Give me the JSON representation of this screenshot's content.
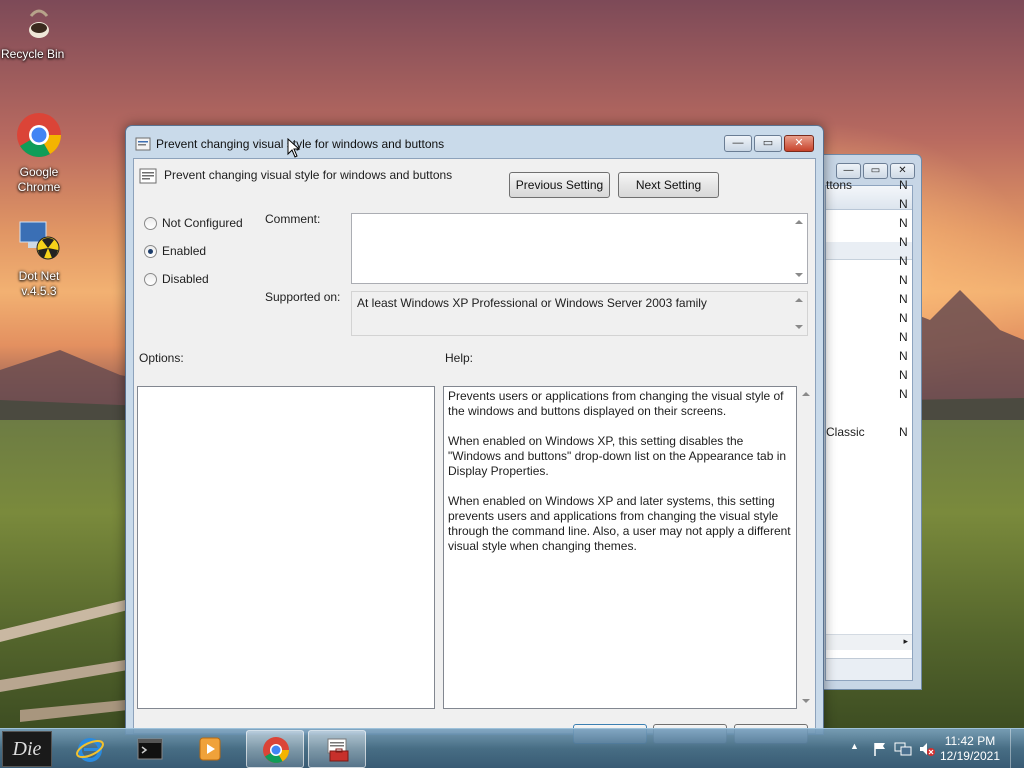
{
  "desktop": {
    "icons": [
      {
        "label": "Recycle Bin"
      },
      {
        "label": "Google Chrome"
      },
      {
        "label": "Dot Net v.4.5.3"
      }
    ]
  },
  "background_window": {
    "rows": [
      {
        "a": "ttons",
        "b": "N"
      },
      {
        "a": "",
        "b": "N"
      },
      {
        "a": "",
        "b": "N"
      },
      {
        "a": "",
        "b": "N"
      },
      {
        "a": "",
        "b": "N"
      },
      {
        "a": "",
        "b": "N"
      },
      {
        "a": "",
        "b": "N"
      },
      {
        "a": "",
        "b": "N"
      },
      {
        "a": "",
        "b": "N"
      },
      {
        "a": "",
        "b": "N"
      },
      {
        "a": "",
        "b": "N"
      },
      {
        "a": "",
        "b": "N"
      },
      {
        "a": "Classic",
        "b": "N"
      }
    ]
  },
  "dialog": {
    "title": "Prevent changing visual style for windows and buttons",
    "policy_name": "Prevent changing visual style for windows and buttons",
    "previous_setting": "Previous Setting",
    "next_setting": "Next Setting",
    "radios": {
      "not_configured": "Not Configured",
      "enabled": "Enabled",
      "disabled": "Disabled",
      "selected": "Enabled"
    },
    "comment_label": "Comment:",
    "comment_value": "",
    "supported_label": "Supported on:",
    "supported_value": "At least Windows XP Professional or Windows Server 2003 family",
    "options_label": "Options:",
    "help_label": "Help:",
    "help_text": "Prevents users or applications from changing the visual style of the windows and buttons displayed on their screens.\n\nWhen enabled on Windows XP, this setting disables the \"Windows and buttons\" drop-down list on the Appearance tab in Display Properties.\n\nWhen enabled on Windows XP and later systems, this setting prevents users and applications from changing the visual style through the command line.  Also, a user may not apply a different visual style when changing themes."
  },
  "taskbar": {
    "start_label": "Die",
    "items": [
      "internet-explorer",
      "cmd",
      "media-player",
      "google-chrome",
      "group-policy-editor"
    ],
    "clock_time": "11:42 PM",
    "clock_date": "12/19/2021"
  }
}
